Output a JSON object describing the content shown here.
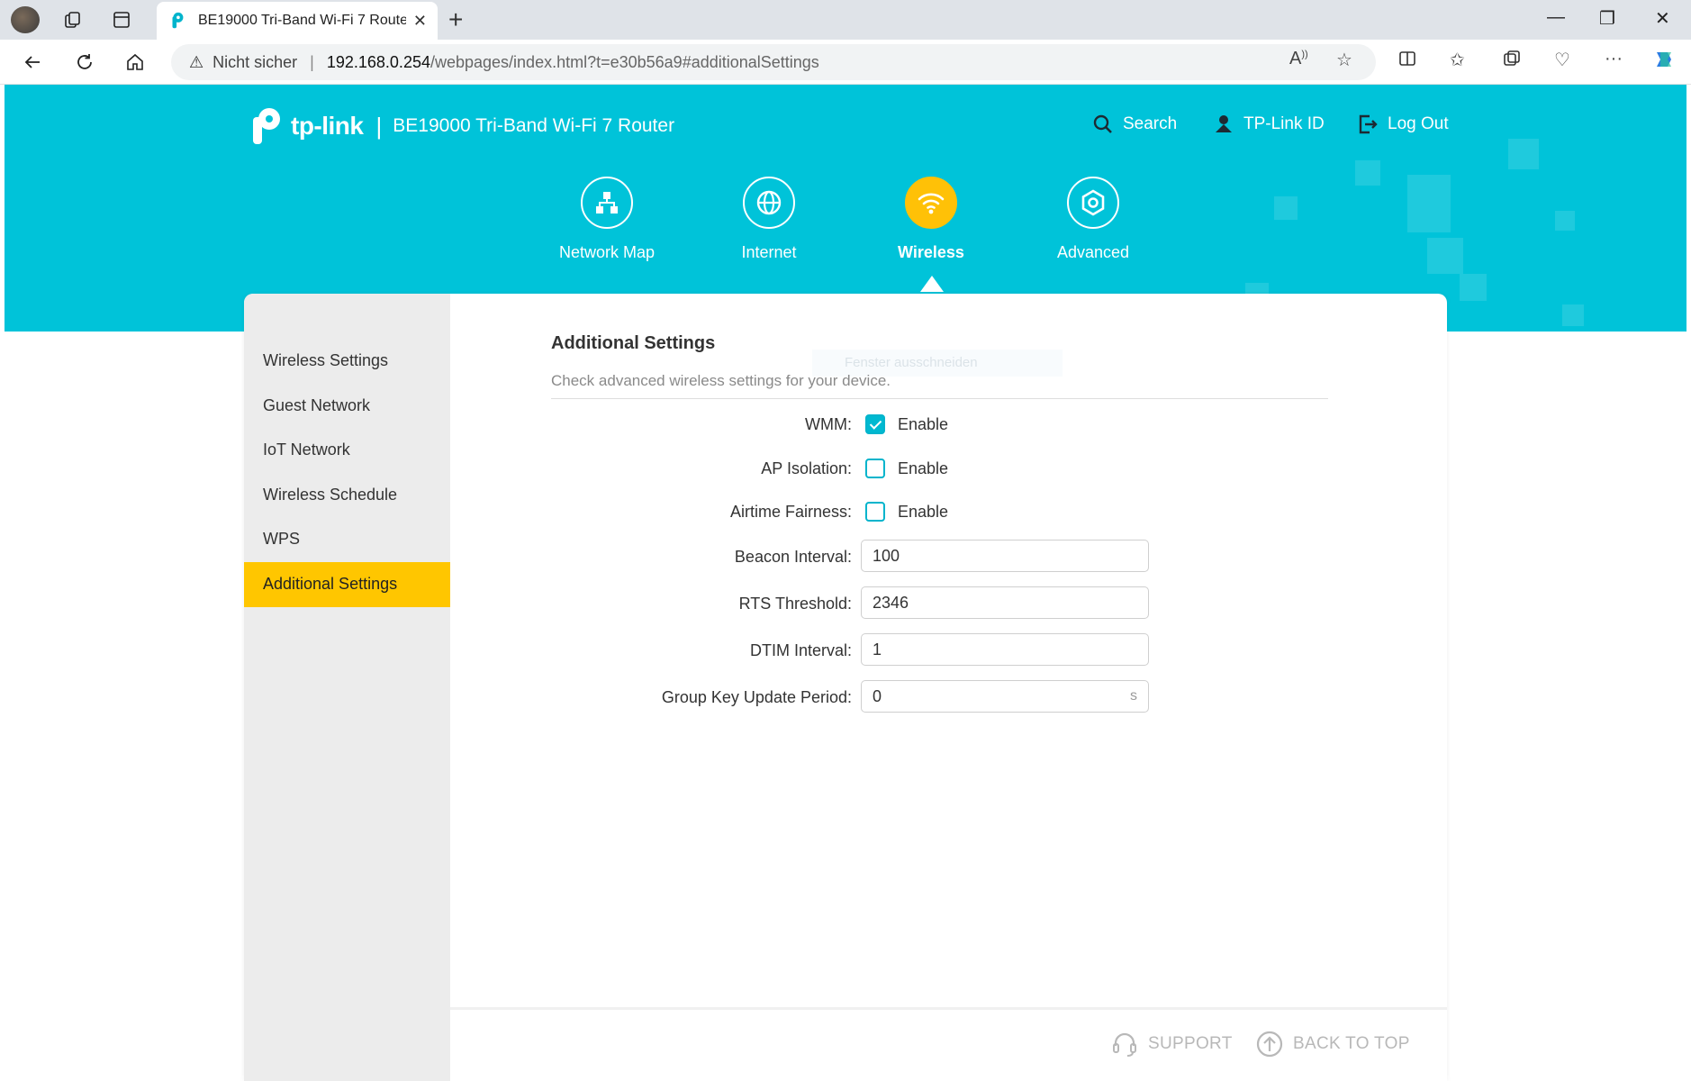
{
  "browser": {
    "tab_title": "BE19000 Tri-Band Wi-Fi 7 Router",
    "security_label": "Nicht sicher",
    "url_host": "192.168.0.254",
    "url_path": "/webpages/index.html?t=e30b56a9#additionalSettings"
  },
  "header": {
    "brand": "tp-link",
    "separator": "|",
    "model": "BE19000 Tri-Band Wi-Fi 7 Router",
    "search_label": "Search",
    "tplink_id_label": "TP-Link ID",
    "logout_label": "Log Out"
  },
  "main_nav": [
    {
      "label": "Network Map",
      "icon": "network-map-icon",
      "active": false
    },
    {
      "label": "Internet",
      "icon": "globe-icon",
      "active": false
    },
    {
      "label": "Wireless",
      "icon": "wifi-icon",
      "active": true
    },
    {
      "label": "Advanced",
      "icon": "gear-icon",
      "active": false
    }
  ],
  "sidebar": {
    "items": [
      {
        "label": "Wireless Settings",
        "active": false
      },
      {
        "label": "Guest Network",
        "active": false
      },
      {
        "label": "IoT Network",
        "active": false
      },
      {
        "label": "Wireless Schedule",
        "active": false
      },
      {
        "label": "WPS",
        "active": false
      },
      {
        "label": "Additional Settings",
        "active": true
      }
    ]
  },
  "section": {
    "title": "Additional Settings",
    "description": "Check advanced wireless settings for your device.",
    "ghost_text": "Fenster ausschneiden"
  },
  "form": {
    "wmm": {
      "label": "WMM:",
      "option": "Enable",
      "checked": true
    },
    "ap_isolation": {
      "label": "AP Isolation:",
      "option": "Enable",
      "checked": false
    },
    "airtime_fairness": {
      "label": "Airtime Fairness:",
      "option": "Enable",
      "checked": false
    },
    "beacon_interval": {
      "label": "Beacon Interval:",
      "value": "100"
    },
    "rts_threshold": {
      "label": "RTS Threshold:",
      "value": "2346"
    },
    "dtim_interval": {
      "label": "DTIM Interval:",
      "value": "1"
    },
    "group_key_update_period": {
      "label": "Group Key Update Period:",
      "value": "0",
      "unit": "s"
    }
  },
  "footer": {
    "support_label": "SUPPORT",
    "back_to_top_label": "BACK TO TOP"
  },
  "colors": {
    "hero": "#00c3d9",
    "accent_yellow": "#ffc600",
    "checkbox": "#00b9d1"
  }
}
